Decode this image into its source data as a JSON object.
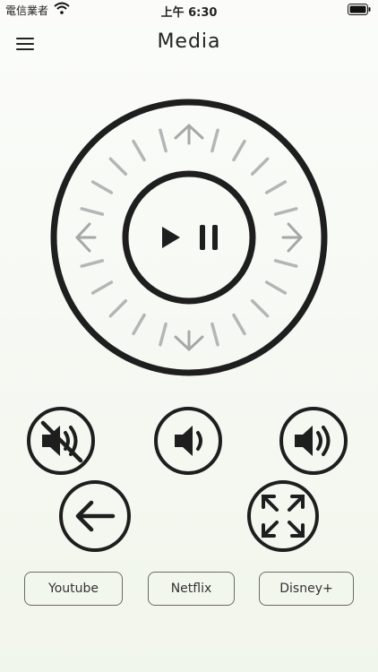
{
  "status_bar": {
    "carrier": "電信業者",
    "time": "上午 6:30"
  },
  "header": {
    "title": "Media"
  },
  "services": [
    {
      "label": "Youtube"
    },
    {
      "label": "Netflix"
    },
    {
      "label": "Disney+"
    }
  ],
  "icons": {
    "menu": "hamburger-menu-icon",
    "play_pause": "play-pause-icon",
    "mute": "volume-mute-icon",
    "volume_down": "volume-down-icon",
    "volume_up": "volume-up-icon",
    "back": "arrow-left-icon",
    "fullscreen": "expand-icon"
  },
  "colors": {
    "stroke": "#1e1e1e",
    "tick": "#b5b5b5",
    "arrow": "#a7a7a7"
  }
}
